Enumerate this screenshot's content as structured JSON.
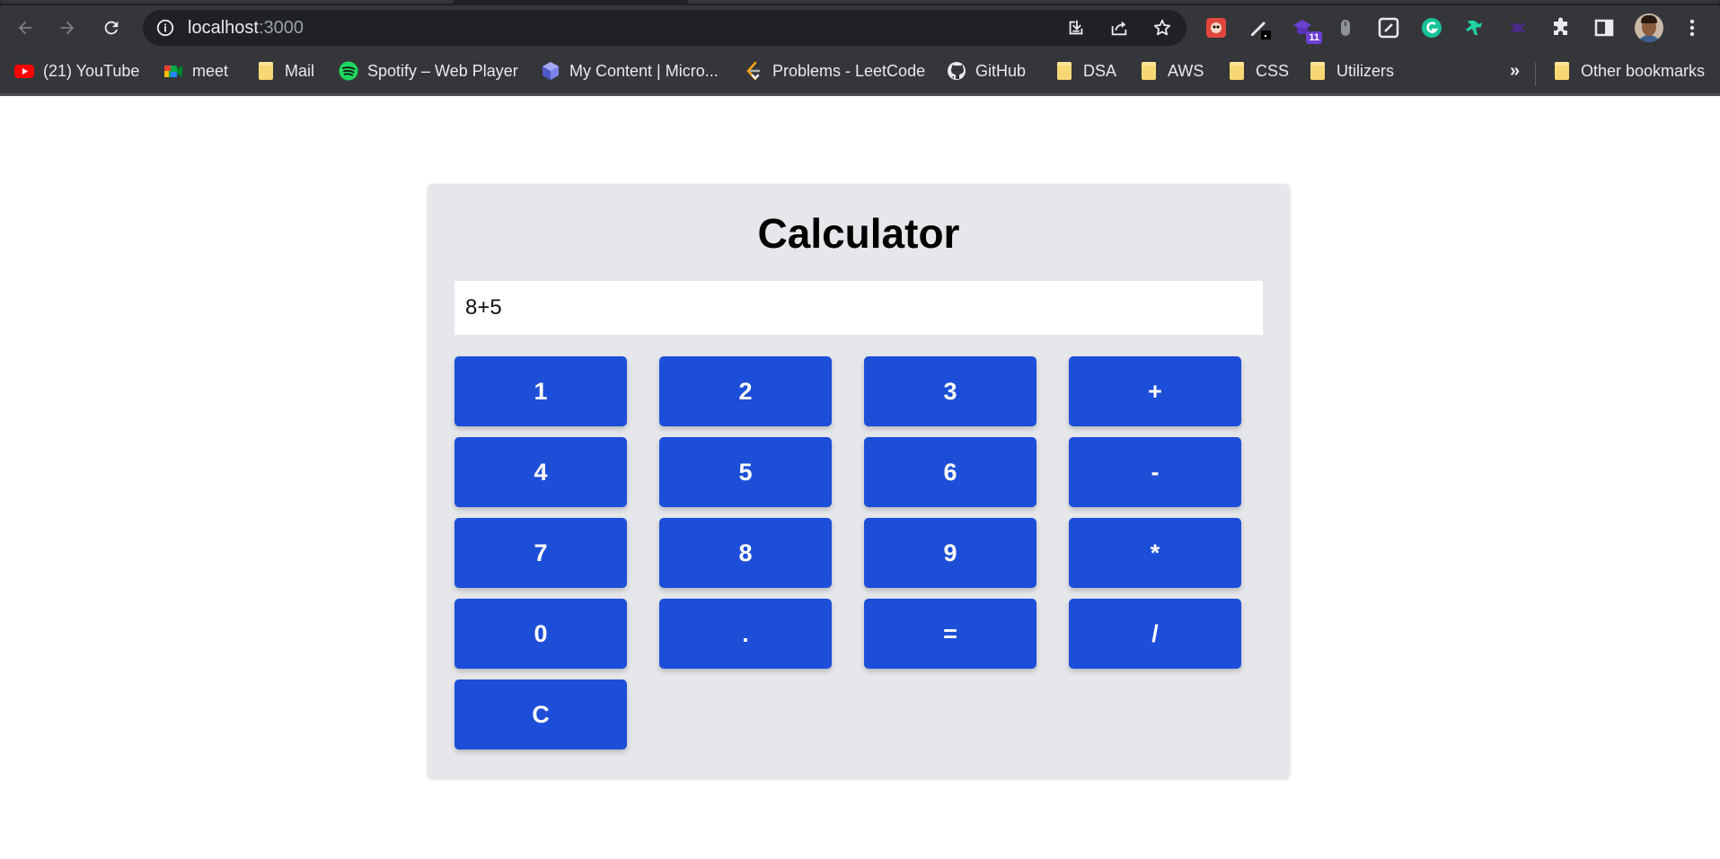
{
  "browser": {
    "url_host": "localhost",
    "url_port": ":3000",
    "extension_badge": "11"
  },
  "bookmarks": [
    {
      "label": "(21) YouTube",
      "icon": "youtube-icon"
    },
    {
      "label": "meet",
      "icon": "google-meet-icon"
    },
    {
      "label": "Mail",
      "icon": "folder-icon"
    },
    {
      "label": "Spotify – Web Player",
      "icon": "spotify-icon"
    },
    {
      "label": "My Content | Micro...",
      "icon": "microsoft-learn-icon"
    },
    {
      "label": "Problems - LeetCode",
      "icon": "leetcode-icon"
    },
    {
      "label": "GitHub",
      "icon": "github-icon"
    },
    {
      "label": "DSA",
      "icon": "folder-icon"
    },
    {
      "label": "AWS",
      "icon": "folder-icon"
    },
    {
      "label": "CSS",
      "icon": "folder-icon"
    },
    {
      "label": "Utilizers",
      "icon": "folder-icon"
    }
  ],
  "bookmarks_overflow": "»",
  "other_bookmarks": "Other bookmarks",
  "calculator": {
    "title": "Calculator",
    "display_value": "8+5",
    "keys": [
      "1",
      "2",
      "3",
      "+",
      "4",
      "5",
      "6",
      "-",
      "7",
      "8",
      "9",
      "*",
      "0",
      ".",
      "=",
      "/",
      "C"
    ]
  },
  "colors": {
    "button_blue": "#1d4ed8",
    "panel_gray": "#e5e7eb",
    "chrome_dark": "#35363a"
  }
}
